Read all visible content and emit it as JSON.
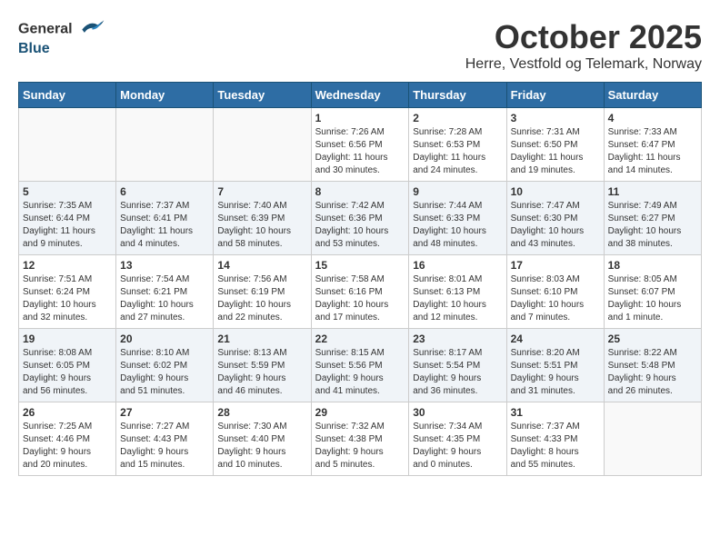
{
  "logo": {
    "general": "General",
    "blue": "Blue"
  },
  "title": "October 2025",
  "location": "Herre, Vestfold og Telemark, Norway",
  "days_of_week": [
    "Sunday",
    "Monday",
    "Tuesday",
    "Wednesday",
    "Thursday",
    "Friday",
    "Saturday"
  ],
  "weeks": [
    [
      {
        "day": "",
        "info": ""
      },
      {
        "day": "",
        "info": ""
      },
      {
        "day": "",
        "info": ""
      },
      {
        "day": "1",
        "info": "Sunrise: 7:26 AM\nSunset: 6:56 PM\nDaylight: 11 hours\nand 30 minutes."
      },
      {
        "day": "2",
        "info": "Sunrise: 7:28 AM\nSunset: 6:53 PM\nDaylight: 11 hours\nand 24 minutes."
      },
      {
        "day": "3",
        "info": "Sunrise: 7:31 AM\nSunset: 6:50 PM\nDaylight: 11 hours\nand 19 minutes."
      },
      {
        "day": "4",
        "info": "Sunrise: 7:33 AM\nSunset: 6:47 PM\nDaylight: 11 hours\nand 14 minutes."
      }
    ],
    [
      {
        "day": "5",
        "info": "Sunrise: 7:35 AM\nSunset: 6:44 PM\nDaylight: 11 hours\nand 9 minutes."
      },
      {
        "day": "6",
        "info": "Sunrise: 7:37 AM\nSunset: 6:41 PM\nDaylight: 11 hours\nand 4 minutes."
      },
      {
        "day": "7",
        "info": "Sunrise: 7:40 AM\nSunset: 6:39 PM\nDaylight: 10 hours\nand 58 minutes."
      },
      {
        "day": "8",
        "info": "Sunrise: 7:42 AM\nSunset: 6:36 PM\nDaylight: 10 hours\nand 53 minutes."
      },
      {
        "day": "9",
        "info": "Sunrise: 7:44 AM\nSunset: 6:33 PM\nDaylight: 10 hours\nand 48 minutes."
      },
      {
        "day": "10",
        "info": "Sunrise: 7:47 AM\nSunset: 6:30 PM\nDaylight: 10 hours\nand 43 minutes."
      },
      {
        "day": "11",
        "info": "Sunrise: 7:49 AM\nSunset: 6:27 PM\nDaylight: 10 hours\nand 38 minutes."
      }
    ],
    [
      {
        "day": "12",
        "info": "Sunrise: 7:51 AM\nSunset: 6:24 PM\nDaylight: 10 hours\nand 32 minutes."
      },
      {
        "day": "13",
        "info": "Sunrise: 7:54 AM\nSunset: 6:21 PM\nDaylight: 10 hours\nand 27 minutes."
      },
      {
        "day": "14",
        "info": "Sunrise: 7:56 AM\nSunset: 6:19 PM\nDaylight: 10 hours\nand 22 minutes."
      },
      {
        "day": "15",
        "info": "Sunrise: 7:58 AM\nSunset: 6:16 PM\nDaylight: 10 hours\nand 17 minutes."
      },
      {
        "day": "16",
        "info": "Sunrise: 8:01 AM\nSunset: 6:13 PM\nDaylight: 10 hours\nand 12 minutes."
      },
      {
        "day": "17",
        "info": "Sunrise: 8:03 AM\nSunset: 6:10 PM\nDaylight: 10 hours\nand 7 minutes."
      },
      {
        "day": "18",
        "info": "Sunrise: 8:05 AM\nSunset: 6:07 PM\nDaylight: 10 hours\nand 1 minute."
      }
    ],
    [
      {
        "day": "19",
        "info": "Sunrise: 8:08 AM\nSunset: 6:05 PM\nDaylight: 9 hours\nand 56 minutes."
      },
      {
        "day": "20",
        "info": "Sunrise: 8:10 AM\nSunset: 6:02 PM\nDaylight: 9 hours\nand 51 minutes."
      },
      {
        "day": "21",
        "info": "Sunrise: 8:13 AM\nSunset: 5:59 PM\nDaylight: 9 hours\nand 46 minutes."
      },
      {
        "day": "22",
        "info": "Sunrise: 8:15 AM\nSunset: 5:56 PM\nDaylight: 9 hours\nand 41 minutes."
      },
      {
        "day": "23",
        "info": "Sunrise: 8:17 AM\nSunset: 5:54 PM\nDaylight: 9 hours\nand 36 minutes."
      },
      {
        "day": "24",
        "info": "Sunrise: 8:20 AM\nSunset: 5:51 PM\nDaylight: 9 hours\nand 31 minutes."
      },
      {
        "day": "25",
        "info": "Sunrise: 8:22 AM\nSunset: 5:48 PM\nDaylight: 9 hours\nand 26 minutes."
      }
    ],
    [
      {
        "day": "26",
        "info": "Sunrise: 7:25 AM\nSunset: 4:46 PM\nDaylight: 9 hours\nand 20 minutes."
      },
      {
        "day": "27",
        "info": "Sunrise: 7:27 AM\nSunset: 4:43 PM\nDaylight: 9 hours\nand 15 minutes."
      },
      {
        "day": "28",
        "info": "Sunrise: 7:30 AM\nSunset: 4:40 PM\nDaylight: 9 hours\nand 10 minutes."
      },
      {
        "day": "29",
        "info": "Sunrise: 7:32 AM\nSunset: 4:38 PM\nDaylight: 9 hours\nand 5 minutes."
      },
      {
        "day": "30",
        "info": "Sunrise: 7:34 AM\nSunset: 4:35 PM\nDaylight: 9 hours\nand 0 minutes."
      },
      {
        "day": "31",
        "info": "Sunrise: 7:37 AM\nSunset: 4:33 PM\nDaylight: 8 hours\nand 55 minutes."
      },
      {
        "day": "",
        "info": ""
      }
    ]
  ]
}
